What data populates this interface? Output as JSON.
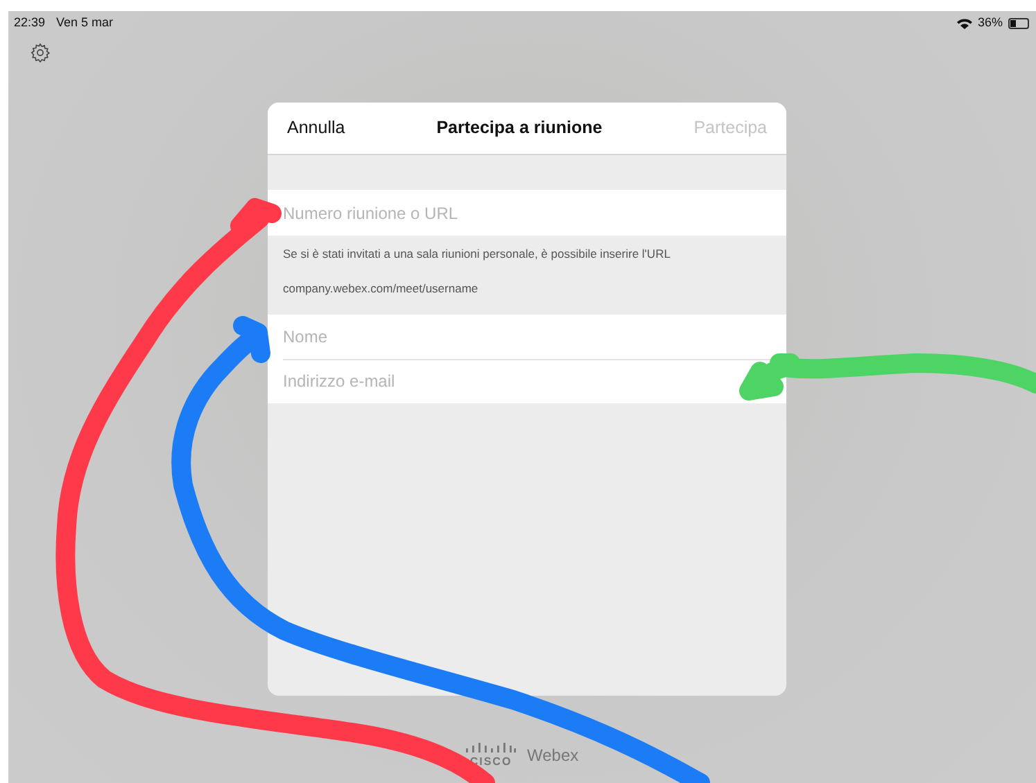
{
  "status_bar": {
    "time": "22:39",
    "date": "Ven 5 mar",
    "battery": "36%"
  },
  "dialog": {
    "cancel": "Annulla",
    "title": "Partecipa a riunione",
    "join": {
      "label": "Partecipa",
      "disabled": true
    },
    "meeting_field": {
      "placeholder": "Numero riunione o URL"
    },
    "hint": [
      "Se si è stati invitati a una sala riunioni personale, è possibile inserire l'URL",
      "company.webex.com/meet/username"
    ],
    "fields": [
      {
        "placeholder": "Nome"
      },
      {
        "placeholder": "Indirizzo e-mail"
      }
    ]
  },
  "footer": {
    "logo_word": "CISCO",
    "product": "Webex"
  },
  "annotations": [
    {
      "color": "#fe3a4a"
    },
    {
      "color": "#1c7cf5"
    },
    {
      "color": "#4dd465"
    }
  ]
}
